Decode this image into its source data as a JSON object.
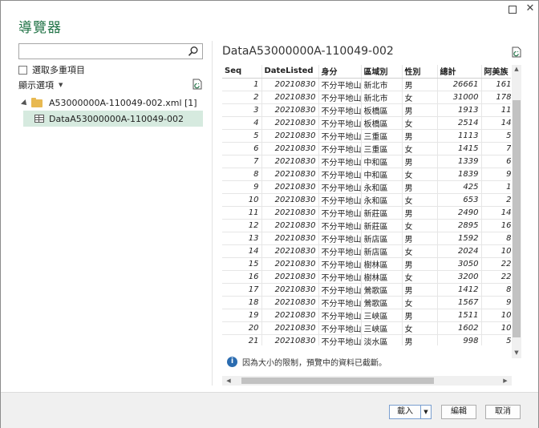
{
  "window": {
    "title": "導覽器",
    "maximize_icon": "maximize-icon",
    "close_icon": "close-icon"
  },
  "sidebar": {
    "search_placeholder": "",
    "search_icon": "search-icon",
    "multi_select_label": "選取多重項目",
    "display_options_label": "顯示選項",
    "refresh_icon": "refresh-icon",
    "tree": {
      "folder_label": "A53000000A-110049-002.xml [1]",
      "table_label": "DataA53000000A-110049-002"
    }
  },
  "preview": {
    "title": "DataA53000000A-110049-002",
    "columns": [
      "Seq",
      "DateListed",
      "身分",
      "區域別",
      "性別",
      "總計",
      "阿美族"
    ],
    "rows": [
      [
        "1",
        "20210830",
        "不分平地山地",
        "新北市",
        "男",
        "26661",
        "161"
      ],
      [
        "2",
        "20210830",
        "不分平地山地",
        "新北市",
        "女",
        "31000",
        "178"
      ],
      [
        "3",
        "20210830",
        "不分平地山地",
        "板橋區",
        "男",
        "1913",
        "11"
      ],
      [
        "4",
        "20210830",
        "不分平地山地",
        "板橋區",
        "女",
        "2514",
        "14"
      ],
      [
        "5",
        "20210830",
        "不分平地山地",
        "三重區",
        "男",
        "1113",
        "5"
      ],
      [
        "6",
        "20210830",
        "不分平地山地",
        "三重區",
        "女",
        "1415",
        "7"
      ],
      [
        "7",
        "20210830",
        "不分平地山地",
        "中和區",
        "男",
        "1339",
        "6"
      ],
      [
        "8",
        "20210830",
        "不分平地山地",
        "中和區",
        "女",
        "1839",
        "9"
      ],
      [
        "9",
        "20210830",
        "不分平地山地",
        "永和區",
        "男",
        "425",
        "1"
      ],
      [
        "10",
        "20210830",
        "不分平地山地",
        "永和區",
        "女",
        "653",
        "2"
      ],
      [
        "11",
        "20210830",
        "不分平地山地",
        "新莊區",
        "男",
        "2490",
        "14"
      ],
      [
        "12",
        "20210830",
        "不分平地山地",
        "新莊區",
        "女",
        "2895",
        "16"
      ],
      [
        "13",
        "20210830",
        "不分平地山地",
        "新店區",
        "男",
        "1592",
        "8"
      ],
      [
        "14",
        "20210830",
        "不分平地山地",
        "新店區",
        "女",
        "2024",
        "10"
      ],
      [
        "15",
        "20210830",
        "不分平地山地",
        "樹林區",
        "男",
        "3050",
        "22"
      ],
      [
        "16",
        "20210830",
        "不分平地山地",
        "樹林區",
        "女",
        "3200",
        "22"
      ],
      [
        "17",
        "20210830",
        "不分平地山地",
        "鶯歌區",
        "男",
        "1412",
        "8"
      ],
      [
        "18",
        "20210830",
        "不分平地山地",
        "鶯歌區",
        "女",
        "1567",
        "9"
      ],
      [
        "19",
        "20210830",
        "不分平地山地",
        "三峽區",
        "男",
        "1511",
        "10"
      ],
      [
        "20",
        "20210830",
        "不分平地山地",
        "三峽區",
        "女",
        "1602",
        "10"
      ],
      [
        "21",
        "20210830",
        "不分平地山地",
        "淡水區",
        "男",
        "998",
        "5"
      ]
    ],
    "notice": "因為大小的限制，預覽中的資料已截斷。",
    "info_icon": "info-icon"
  },
  "footer": {
    "load_label": "載入",
    "edit_label": "編輯",
    "cancel_label": "取消"
  },
  "colors": {
    "accent": "#217346",
    "selection": "#d6eadf"
  }
}
